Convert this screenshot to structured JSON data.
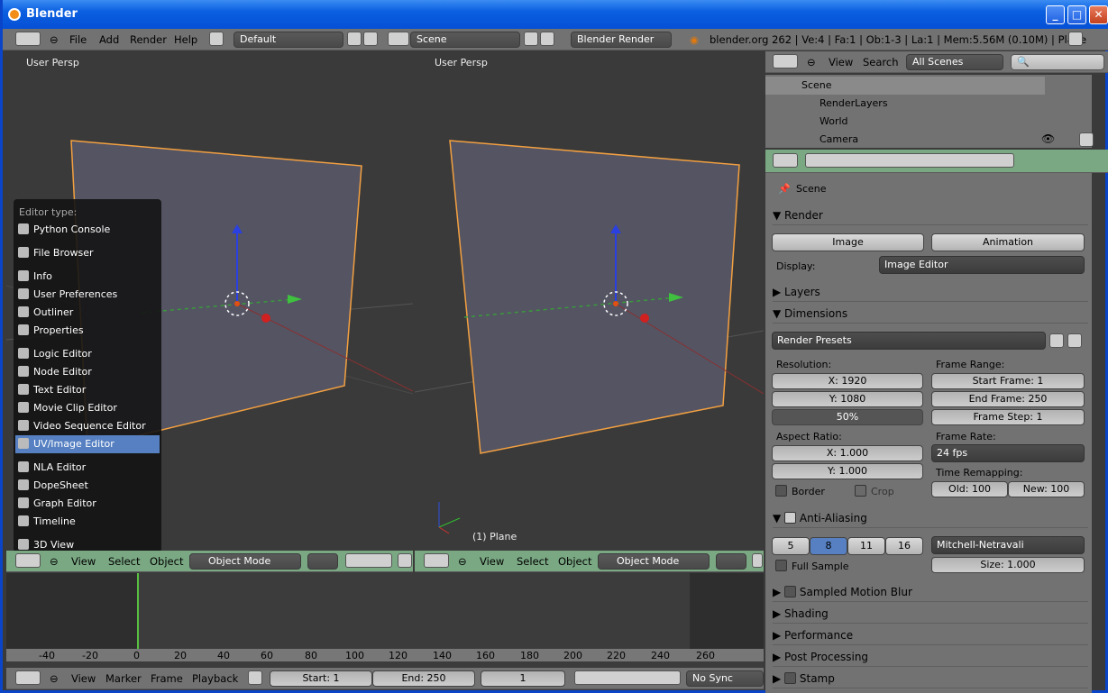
{
  "window": {
    "title": "Blender"
  },
  "topbar": {
    "menus": [
      "File",
      "Add",
      "Render",
      "Help"
    ],
    "layout": "Default",
    "scene": "Scene",
    "engine": "Blender Render",
    "stats": "blender.org 262 | Ve:4 | Fa:1 | Ob:1-3 | La:1 | Mem:5.56M (0.10M) | Plane"
  },
  "viewport_left": {
    "label": "User Persp",
    "footer": "(1) Plane"
  },
  "viewport_right": {
    "label": "User Persp",
    "footer": "(1) Plane"
  },
  "view_header": {
    "items": [
      "View",
      "Select",
      "Object"
    ],
    "mode": "Object Mode"
  },
  "editor_menu": {
    "header": "Editor type:",
    "items": [
      "Python Console",
      "File Browser",
      "Info",
      "User Preferences",
      "Outliner",
      "Properties",
      "Logic Editor",
      "Node Editor",
      "Text Editor",
      "Movie Clip Editor",
      "Video Sequence Editor",
      "UV/Image Editor",
      "NLA Editor",
      "DopeSheet",
      "Graph Editor",
      "Timeline",
      "3D View"
    ],
    "selected": "UV/Image Editor"
  },
  "outliner": {
    "menus": [
      "View",
      "Search"
    ],
    "filter": "All Scenes",
    "rows": [
      "Scene",
      "RenderLayers",
      "World",
      "Camera"
    ]
  },
  "properties": {
    "context": "Scene",
    "render": {
      "title": "Render",
      "image": "Image",
      "animation": "Animation",
      "display_label": "Display:",
      "display": "Image Editor"
    },
    "sections": {
      "layers": "Layers",
      "dimensions": "Dimensions",
      "anti": "Anti-Aliasing",
      "motion": "Sampled Motion Blur",
      "shading": "Shading",
      "performance": "Performance",
      "post": "Post Processing",
      "stamp": "Stamp"
    },
    "dimensions": {
      "presets": "Render Presets",
      "res_label": "Resolution:",
      "x": "X: 1920",
      "y": "Y: 1080",
      "pct": "50%",
      "aspect_label": "Aspect Ratio:",
      "ax": "X: 1.000",
      "ay": "Y: 1.000",
      "border": "Border",
      "crop": "Crop",
      "range_label": "Frame Range:",
      "start": "Start Frame: 1",
      "end": "End Frame: 250",
      "step": "Frame Step: 1",
      "rate_label": "Frame Rate:",
      "rate": "24 fps",
      "remap_label": "Time Remapping:",
      "old": "Old: 100",
      "new": "New: 100"
    },
    "aa": {
      "samples": [
        "5",
        "8",
        "11",
        "16"
      ],
      "selected": "8",
      "filter": "Mitchell-Netravali",
      "full": "Full Sample",
      "size": "Size: 1.000"
    }
  },
  "timeline": {
    "ticks": [
      "-40",
      "-20",
      "0",
      "20",
      "40",
      "60",
      "80",
      "100",
      "120",
      "140",
      "160",
      "180",
      "200",
      "220",
      "240",
      "260"
    ],
    "menus": [
      "View",
      "Marker",
      "Frame",
      "Playback"
    ],
    "start": "Start: 1",
    "end": "End: 250",
    "frame": "1",
    "sync": "No Sync"
  }
}
